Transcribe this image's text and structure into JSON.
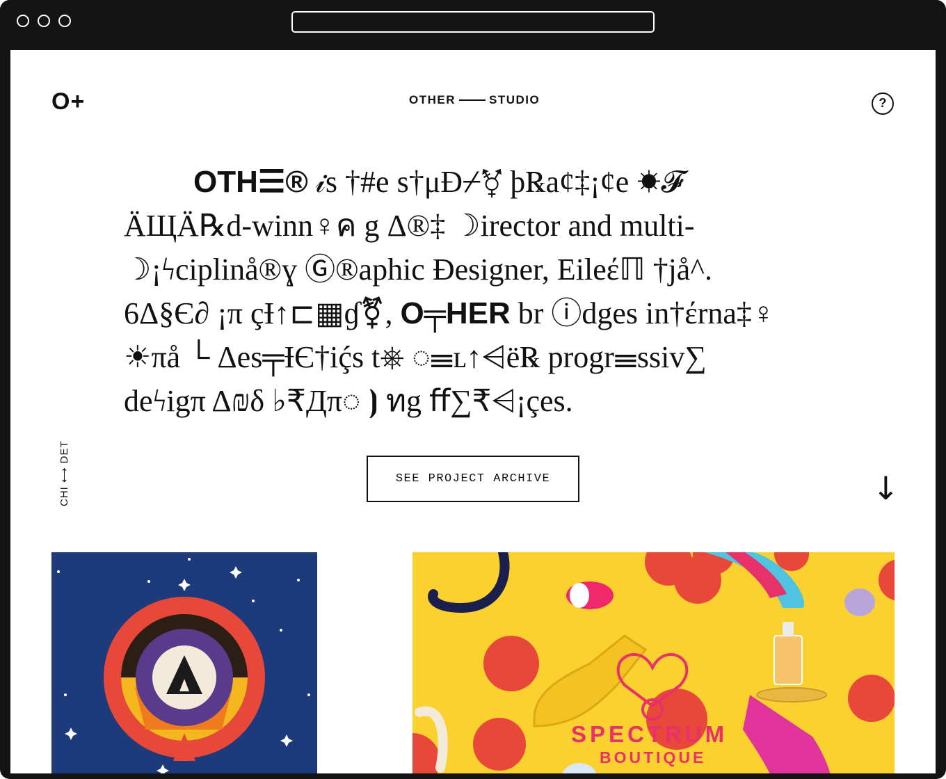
{
  "header": {
    "logo": "O+",
    "studio_left": "OTHER",
    "studio_right": "STUDIO",
    "help_icon": "?"
  },
  "hero": {
    "lines": [
      [
        "OTH☰®",
        " 𝒾s †#e s†μĐ⌿⚧ þ℞a¢‡¡¢e ☀𝓕"
      ],
      [
        "",
        "ÄЩÄ℞d-winn♀ค g  Δ®‡ ☽irector and multi-"
      ],
      [
        "",
        "☽¡ϟciplinå®ɣ Ⓖ®aphic Đesigner, Eileέℿ †jå^."
      ],
      [
        "",
        "6Δ§Є∂ ¡π çƗ↑⊏▦ɠ⚧, "
      ],
      [
        "",
        "☀πå └ Δes╤ƗЄ†iḉs t⎈ ◌☰ʟ↑⩤ë℞ progr☰ssiv∑"
      ],
      [
        "",
        "deϟigπ Δ₪δ ♭₹Дπ◌ ⦘ ทg ﬀ∑₹⩤¡çes."
      ]
    ],
    "line4_bold": "O╤HER",
    "line4_rest": " br ⓘdges in†έrna‡♀"
  },
  "sidebar_vertical": "CHI ⟷ DET",
  "archive_button": "SEE PROJECT ARCHIVE",
  "scroll_arrow": "↓",
  "projects": {
    "right_title": "SPECTRUM",
    "right_subtitle": "BOUTIQUE"
  },
  "colors": {
    "left_card_bg": "#1d3a7a",
    "right_card_bg": "#fbd12f",
    "accent_pink": "#e8306a",
    "accent_red": "#e8483a"
  }
}
